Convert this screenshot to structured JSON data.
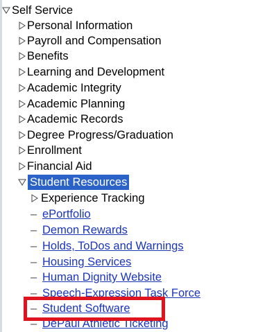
{
  "menu": {
    "root": {
      "label": "Self Service",
      "icon": "triangle-down-icon"
    },
    "items": [
      {
        "label": "Personal Information",
        "icon": "triangle-right-icon"
      },
      {
        "label": "Payroll and Compensation",
        "icon": "triangle-right-icon"
      },
      {
        "label": "Benefits",
        "icon": "triangle-right-icon"
      },
      {
        "label": "Learning and Development",
        "icon": "triangle-right-icon"
      },
      {
        "label": "Academic Integrity",
        "icon": "triangle-right-icon"
      },
      {
        "label": "Academic Planning",
        "icon": "triangle-right-icon"
      },
      {
        "label": "Academic Records",
        "icon": "triangle-right-icon"
      },
      {
        "label": "Degree Progress/Graduation",
        "icon": "triangle-right-icon"
      },
      {
        "label": "Enrollment",
        "icon": "triangle-right-icon"
      },
      {
        "label": "Financial Aid",
        "icon": "triangle-right-icon"
      },
      {
        "label": "Student Resources",
        "icon": "triangle-down-icon",
        "selected": true
      }
    ],
    "student_resources": {
      "folder": {
        "label": "Experience Tracking",
        "icon": "triangle-right-icon"
      },
      "links": [
        "ePortfolio",
        "Demon Rewards",
        "Holds, ToDos and Warnings",
        "Housing Services",
        "Human Dignity Website",
        "Speech-Expression Task Force",
        "Student Software",
        "DePaul Athletic Ticketing"
      ]
    }
  },
  "colors": {
    "link": "#1a35b8",
    "selected_bg": "#2a62c7",
    "highlight_border": "#e0141e"
  }
}
